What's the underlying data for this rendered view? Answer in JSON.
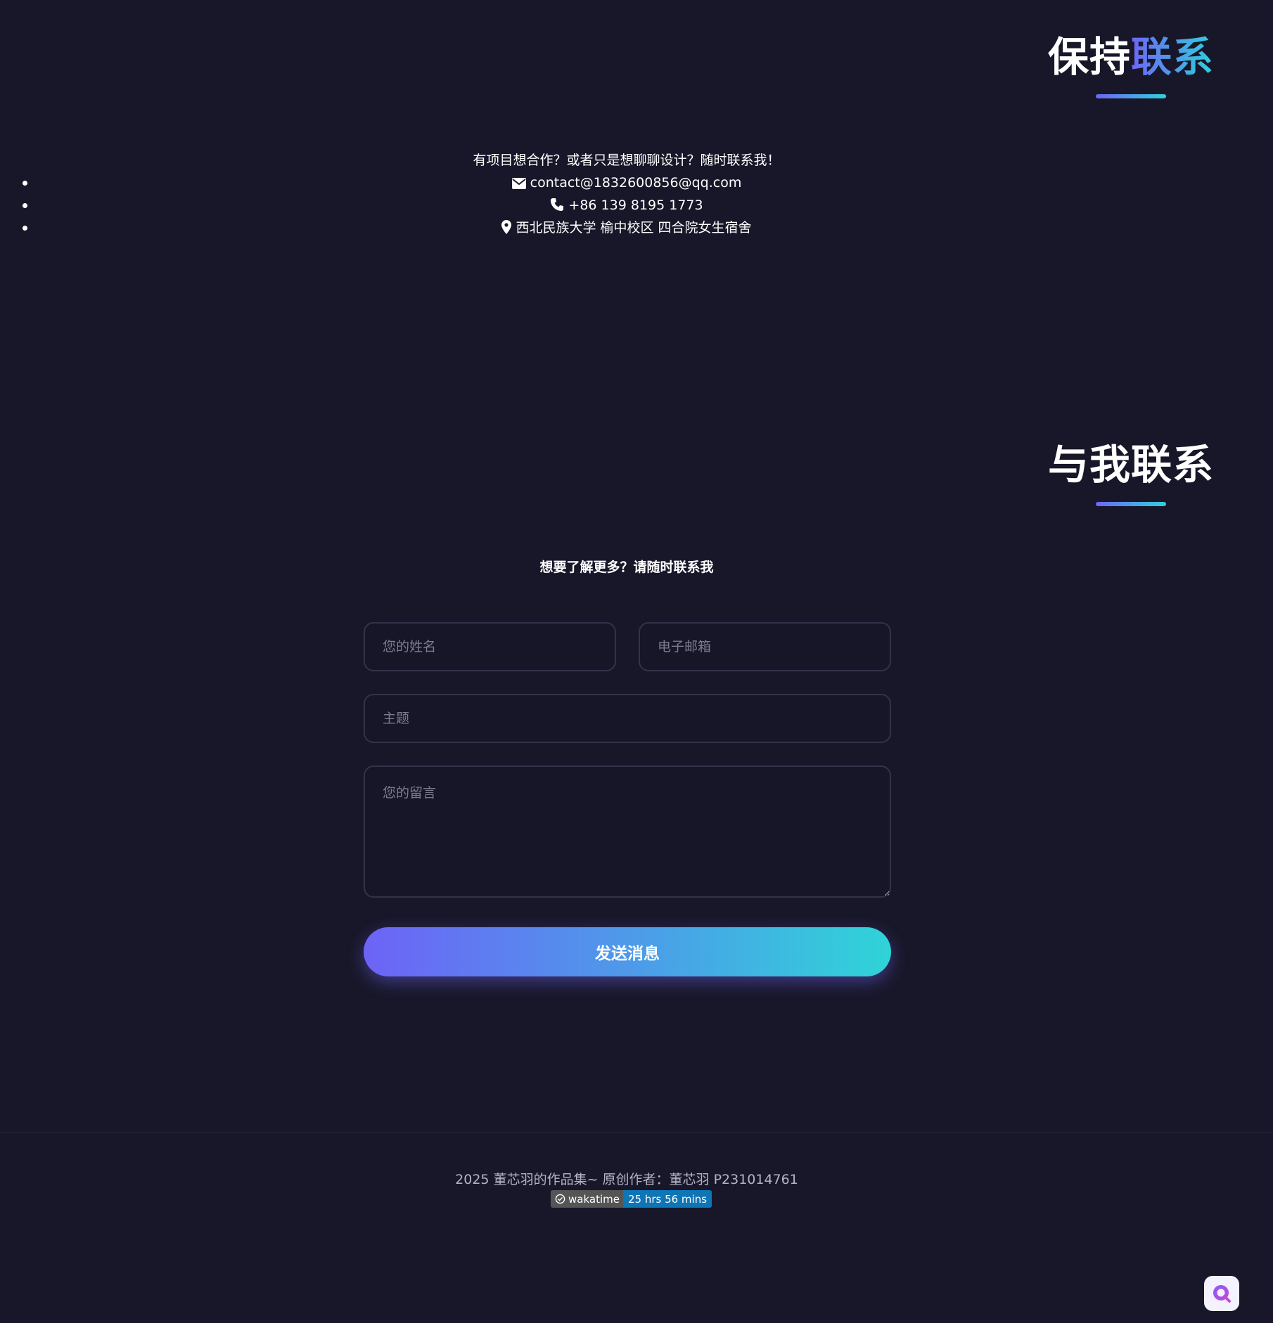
{
  "sections": {
    "keep_in_touch": {
      "title_plain": "保持",
      "title_accent": "联系"
    },
    "contact_me": {
      "title": "与我联系"
    }
  },
  "contact": {
    "intro": "有项目想合作？或者只是想聊聊设计？随时联系我！",
    "email": "contact@1832600856@qq.com",
    "phone": "+86 139 8195 1773",
    "address": "西北民族大学 榆中校区 四合院女生宿舍"
  },
  "form": {
    "intro": "想要了解更多？请随时联系我",
    "name_placeholder": "您的姓名",
    "email_placeholder": "电子邮箱",
    "subject_placeholder": "主题",
    "message_placeholder": "您的留言",
    "submit_label": "发送消息"
  },
  "footer": {
    "text": "2025 董芯羽的作品集~ 原创作者：董芯羽 P231014761",
    "badge_label": "wakatime",
    "badge_value": "25 hrs 56 mins"
  },
  "colors": {
    "background": "#181729",
    "accent_start": "#6d66f5",
    "accent_end": "#2fd0dc"
  }
}
